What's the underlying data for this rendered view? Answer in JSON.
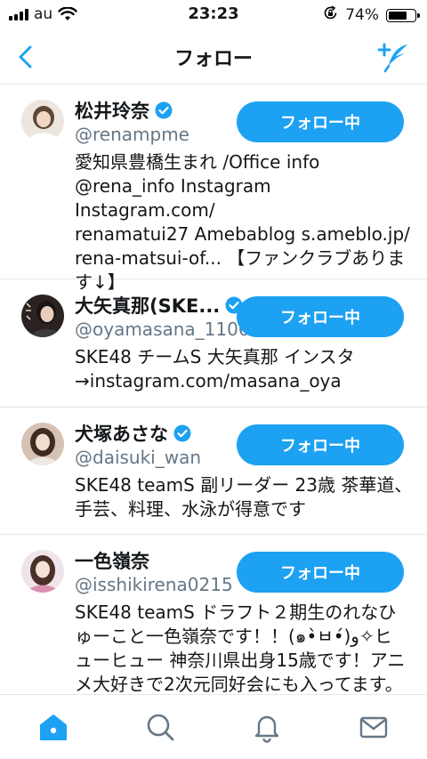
{
  "status_bar": {
    "carrier": "au",
    "time": "23:23",
    "battery_percent": "74%",
    "battery_level": 0.74,
    "icons": [
      "signal-icon",
      "wifi-icon",
      "rotation-lock-icon",
      "battery-icon"
    ]
  },
  "nav": {
    "title": "フォロー",
    "back_icon": "chevron-left-icon",
    "action_icon": "add-account-icon"
  },
  "follow_list": [
    {
      "name": "松井玲奈",
      "handle": "@renampme",
      "verified": true,
      "button_label": "フォロー中",
      "bio_lines": [
        "愛知県豊橋生まれ /Office info",
        "@rena_info Instagram Instagram.com/",
        "renamatui27 Amebablog s.ameblo.jp/",
        "rena-matsui-of... 【ファンクラブありま",
        "す↓】"
      ]
    },
    {
      "name": "大矢真那(SKE...",
      "handle": "@oyamasana_1106",
      "verified": true,
      "button_label": "フォロー中",
      "bio_lines": [
        "SKE48 チームS 大矢真那 インスタ",
        "→instagram.com/masana_oya"
      ]
    },
    {
      "name": "犬塚あさな",
      "handle": "@daisuki_wan",
      "verified": true,
      "button_label": "フォロー中",
      "bio_lines": [
        "SKE48 teamS 副リーダー 23歳 茶華道、",
        "手芸、料理、水泳が得意です"
      ]
    },
    {
      "name": "一色嶺奈",
      "handle": "@isshikirena0215",
      "verified": false,
      "button_label": "フォロー中",
      "bio_lines": [
        "SKE48 teamS ドラフト２期生のれなひ",
        "ゅーこと一色嶺奈です！！(๑•̀ㅂ•́)و✧ヒ",
        "ューヒュー 神奈川県出身15歳です！アニ",
        "メ大好きで2次元同好会にも入ってます。"
      ]
    }
  ],
  "tab_bar": {
    "tabs": [
      "home-icon",
      "search-icon",
      "notifications-icon",
      "messages-icon"
    ],
    "active": "home-icon"
  },
  "colors": {
    "accent": "#1da1f2",
    "text": "#14171a",
    "secondary_text": "#657786",
    "divider": "#e1e8ed"
  }
}
